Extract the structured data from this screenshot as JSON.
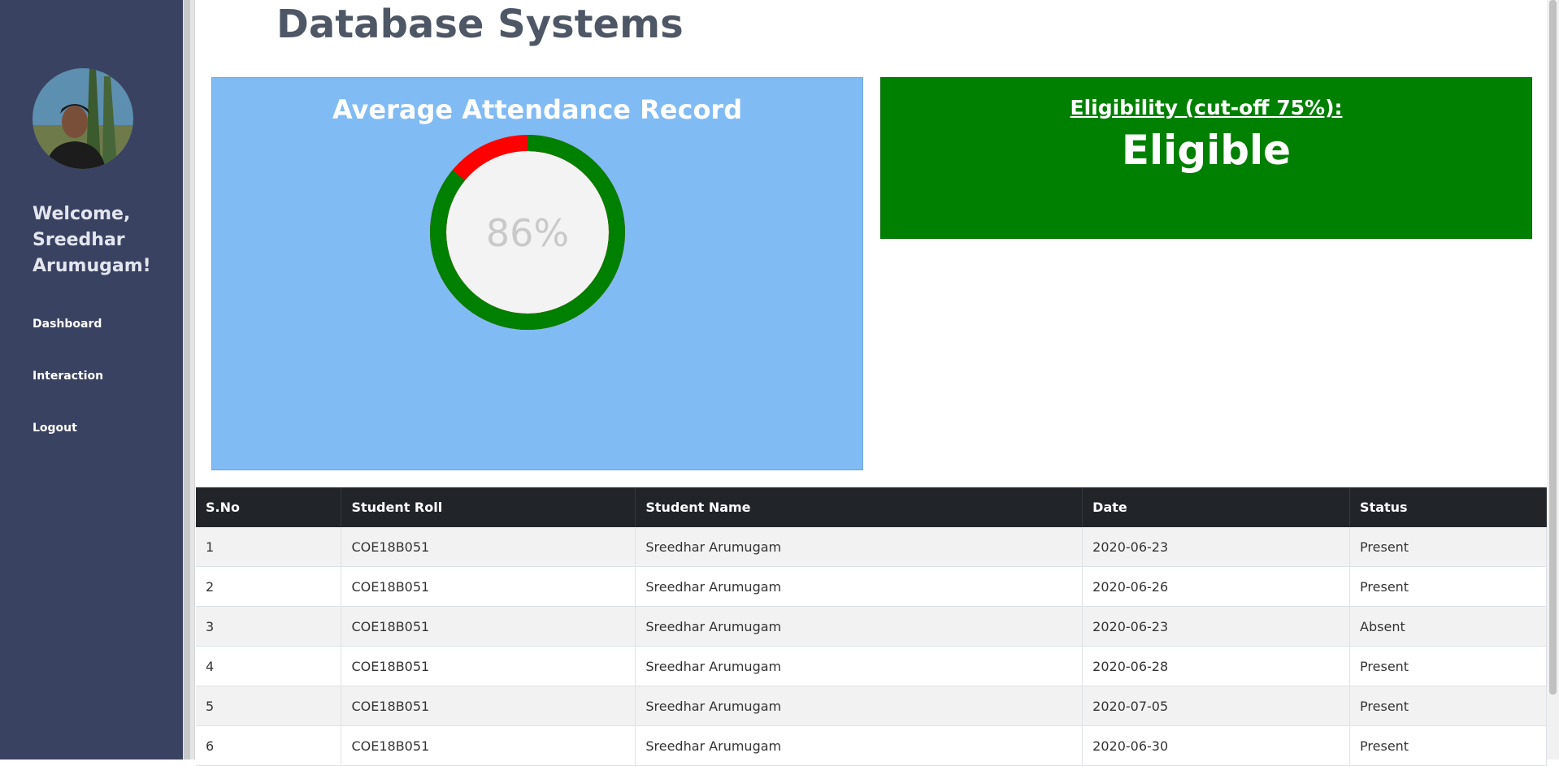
{
  "page": {
    "title": "Database Systems"
  },
  "sidebar": {
    "welcome": "Welcome, Sreedhar Arumugam!",
    "nav": [
      {
        "label": "Dashboard"
      },
      {
        "label": "Interaction"
      },
      {
        "label": "Logout"
      }
    ]
  },
  "attendance_card": {
    "title": "Average Attendance Record",
    "percent_label": "86%",
    "percent_value": 86,
    "present_color": "#008000",
    "absent_color": "#ff0000",
    "card_color": "#80bbf4"
  },
  "eligibility": {
    "label": "Eligibility (cut-off 75%):",
    "value": "Eligible",
    "color": "#008000"
  },
  "table": {
    "headers": [
      "S.No",
      "Student Roll",
      "Student Name",
      "Date",
      "Status"
    ],
    "rows": [
      [
        "1",
        "COE18B051",
        "Sreedhar Arumugam",
        "2020-06-23",
        "Present"
      ],
      [
        "2",
        "COE18B051",
        "Sreedhar Arumugam",
        "2020-06-26",
        "Present"
      ],
      [
        "3",
        "COE18B051",
        "Sreedhar Arumugam",
        "2020-06-23",
        "Absent"
      ],
      [
        "4",
        "COE18B051",
        "Sreedhar Arumugam",
        "2020-06-28",
        "Present"
      ],
      [
        "5",
        "COE18B051",
        "Sreedhar Arumugam",
        "2020-07-05",
        "Present"
      ],
      [
        "6",
        "COE18B051",
        "Sreedhar Arumugam",
        "2020-06-30",
        "Present"
      ]
    ]
  }
}
